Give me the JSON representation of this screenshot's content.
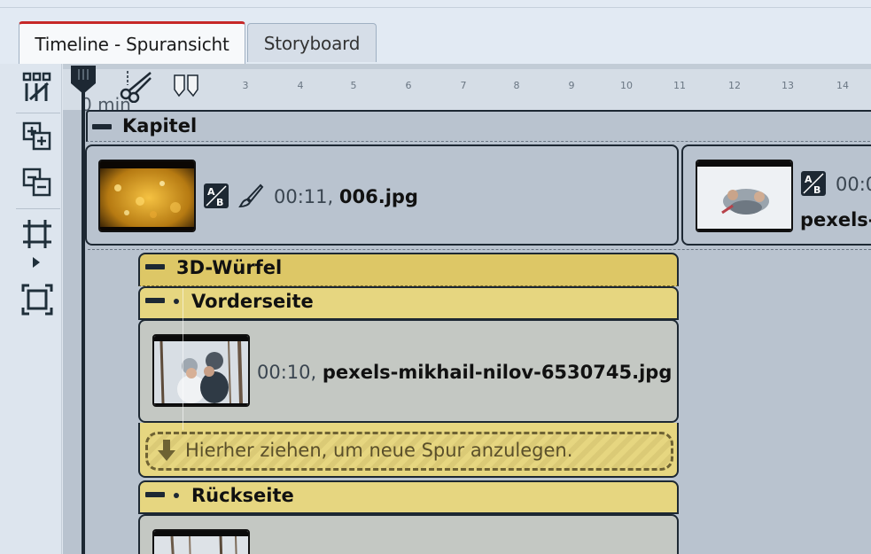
{
  "tabs": {
    "timeline": "Timeline - Spuransicht",
    "storyboard": "Storyboard"
  },
  "ruler": {
    "unit_label": "0 min",
    "ticks": [
      "3",
      "4",
      "5",
      "6",
      "7",
      "8",
      "9",
      "10",
      "11",
      "12",
      "13",
      "14"
    ]
  },
  "kapitel": {
    "label": "Kapitel",
    "clip1": {
      "time": "00:11,",
      "name": "006.jpg"
    },
    "clip2": {
      "time": "00:0",
      "name": "pexels-r"
    }
  },
  "cube": {
    "label": "3D-Würfel",
    "front": {
      "label": "Vorderseite",
      "clip": {
        "time": "00:10,",
        "name": "pexels-mikhail-nilov-6530745.jpg"
      },
      "drop_hint": "Hierher ziehen, um neue Spur anzulegen."
    },
    "back": {
      "label": "Rückseite"
    }
  },
  "toolbar_icons": [
    "track-properties-icon",
    "add-track-icon",
    "remove-track-icon",
    "fit-frame-icon",
    "expand-frame-icon"
  ],
  "colors": {
    "accent": "#c62828",
    "cube_header": "#ddc766",
    "face_header": "#e6d680",
    "timeline_bg": "#b9c3cf"
  }
}
